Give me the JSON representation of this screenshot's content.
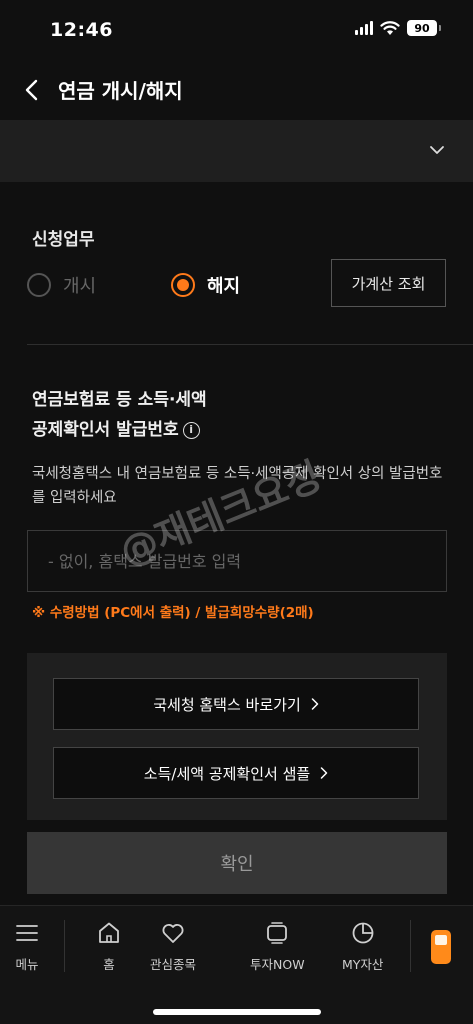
{
  "status": {
    "time": "12:46",
    "battery": "90"
  },
  "header": {
    "title": "연금 개시/해지"
  },
  "form": {
    "section_label": "신청업무",
    "options": [
      {
        "label": "개시",
        "selected": false
      },
      {
        "label": "해지",
        "selected": true
      }
    ],
    "household_button": "가계산 조회",
    "field_title_line1": "연금보험료 등 소득·세액",
    "field_title_line2": "공제확인서 발급번호",
    "description": "국세청홈택스 내 연금보험료 등 소득·세액공제 확인서 상의 발급번호를 입력하세요",
    "input_placeholder": "- 없이, 홈택스 발급번호 입력",
    "input_value": "",
    "notice": "※ 수령방법 (PC에서 출력) / 발급희망수량(2매)"
  },
  "links": {
    "hometax": "국세청 홈택스 바로가기",
    "sample": "소득/세액 공제확인서 샘플"
  },
  "confirm_label": "확인",
  "watermark": "@재테크요정",
  "tabs": [
    {
      "label": "메뉴",
      "icon": "menu-icon"
    },
    {
      "label": "홈",
      "icon": "home-icon"
    },
    {
      "label": "관심종목",
      "icon": "heart-icon"
    },
    {
      "label": "투자NOW",
      "icon": "tv-icon"
    },
    {
      "label": "MY자산",
      "icon": "pie-chart-icon"
    }
  ],
  "colors": {
    "accent": "#ff7a1a",
    "background": "#101010",
    "panel": "#1f1f1f"
  }
}
